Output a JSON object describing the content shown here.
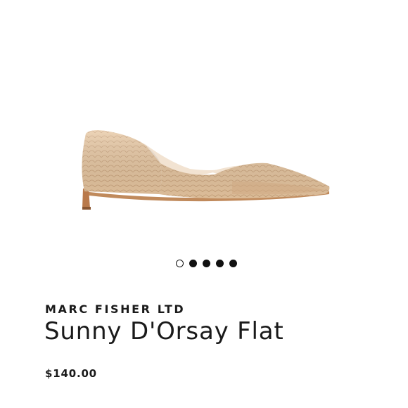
{
  "product": {
    "image_alt": "Sunny D'Orsay Flat shoe",
    "brand": "MARC FISHER LTD",
    "name": "Sunny D'Orsay Flat",
    "price": "$140.00"
  },
  "carousel": {
    "total": 5,
    "active_index": 0
  },
  "colors": {
    "shoe_body": "#e9c9a4",
    "shoe_shade": "#d8b088",
    "sole": "#b9794a",
    "lining": "#f2e3d2"
  }
}
